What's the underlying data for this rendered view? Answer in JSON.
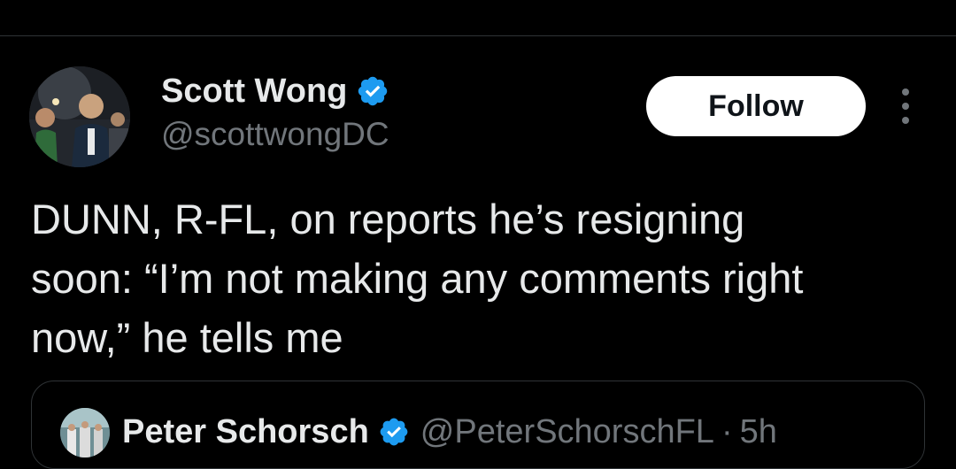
{
  "tweet": {
    "author": {
      "name": "Scott Wong",
      "handle": "@scottwongDC",
      "verified": true,
      "avatar": "avatar-photo"
    },
    "follow_label": "Follow",
    "more_icon": "more-vertical-icon",
    "text_lines": [
      "DUNN, R-FL, on reports he’s resigning",
      "soon: “I’m not making any comments right",
      "now,” he tells me"
    ]
  },
  "quoted_tweet": {
    "author_name": "Peter Schorsch",
    "handle": "@PeterSchorschFL",
    "separator": "·",
    "time": "5h",
    "verified": true
  },
  "colors": {
    "background": "#000000",
    "text_primary": "#e7e9ea",
    "text_secondary": "#71767b",
    "verified_blue": "#1d9bf0",
    "divider": "#2f3336",
    "follow_bg": "#ffffff",
    "follow_text": "#0f1419"
  }
}
